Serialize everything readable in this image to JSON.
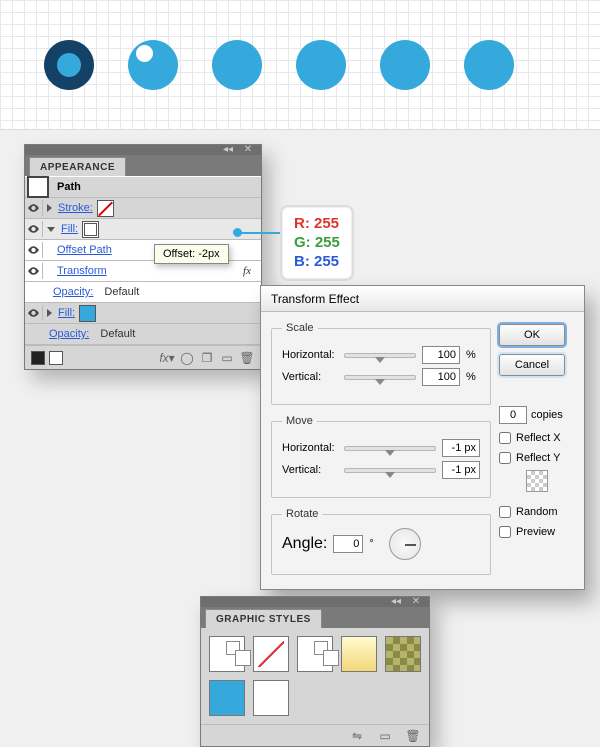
{
  "canvas": {
    "circles": [
      "donut",
      "highlight",
      "plain",
      "plain",
      "plain",
      "plain"
    ]
  },
  "appearance": {
    "title": "APPEARANCE",
    "path_label": "Path",
    "stroke_label": "Stroke:",
    "fill_label": "Fill:",
    "offset_path": "Offset Path",
    "transform": "Transform",
    "opacity_label": "Opacity:",
    "opacity_value": "Default",
    "fx_label": "fx"
  },
  "offset_tooltip": "Offset: -2px",
  "rgb_readout": {
    "r_label": "R:",
    "r": "255",
    "g_label": "G:",
    "g": "255",
    "b_label": "B:",
    "b": "255"
  },
  "transform_dialog": {
    "title": "Transform Effect",
    "scale_legend": "Scale",
    "move_legend": "Move",
    "rotate_legend": "Rotate",
    "horizontal": "Horizontal:",
    "vertical": "Vertical:",
    "angle_label": "Angle:",
    "scale_h": "100",
    "scale_v": "100",
    "move_h": "-1 px",
    "move_v": "-1 px",
    "angle": "0",
    "ok": "OK",
    "cancel": "Cancel",
    "copies_value": "0",
    "copies_label": "copies",
    "reflect_x": "Reflect X",
    "reflect_y": "Reflect Y",
    "random": "Random",
    "preview": "Preview",
    "percent": "%",
    "degree": "°"
  },
  "graphic_styles": {
    "title": "GRAPHIC STYLES"
  }
}
